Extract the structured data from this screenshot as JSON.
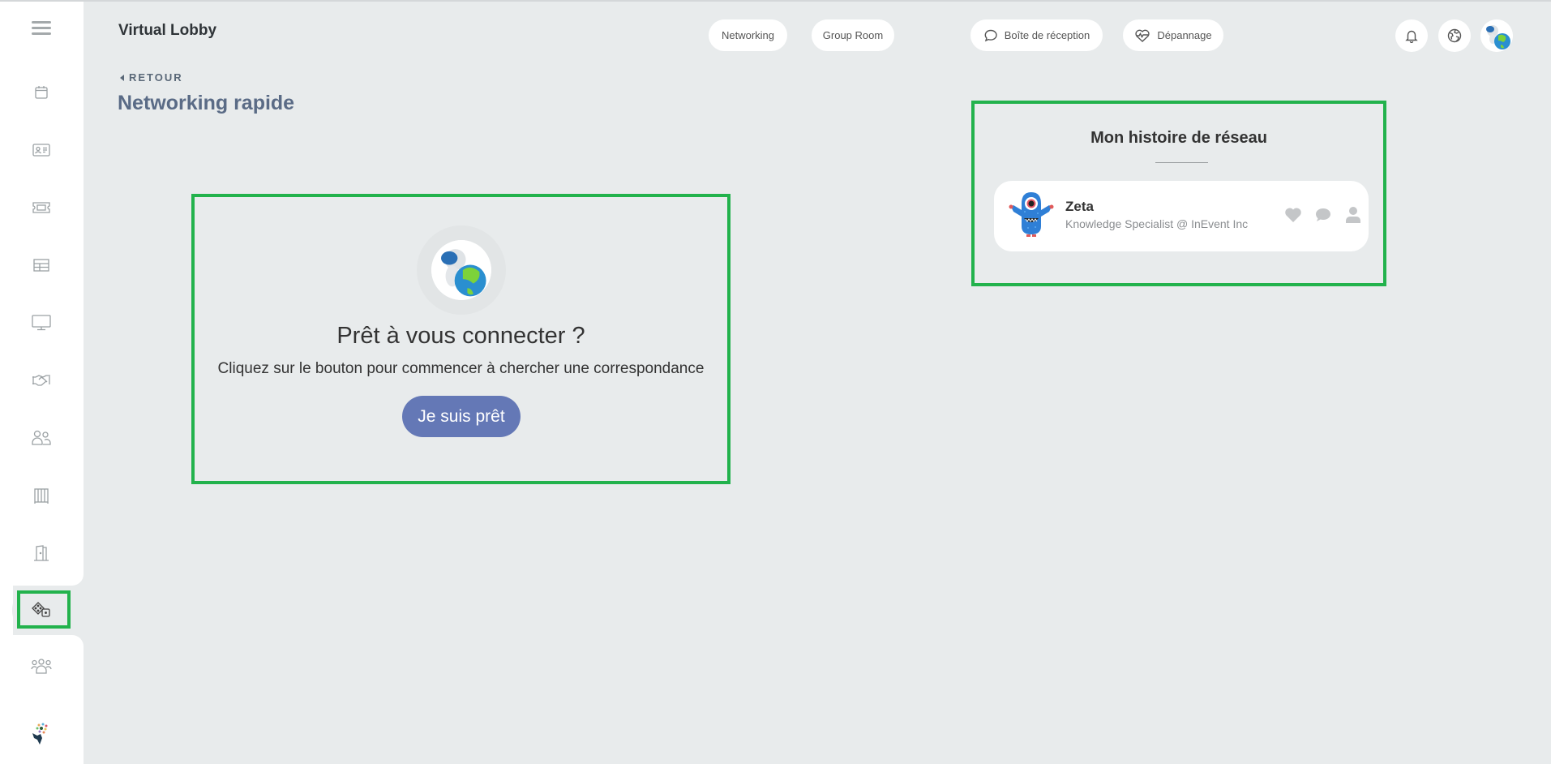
{
  "header": {
    "app_title": "Virtual Lobby",
    "pills": [
      {
        "label": "Networking",
        "icon": ""
      },
      {
        "label": "Group Room",
        "icon": ""
      },
      {
        "label": "Boîte de réception",
        "icon": "chat-bubble-icon"
      },
      {
        "label": "Dépannage",
        "icon": "heartbeat-icon"
      }
    ],
    "right_icons": [
      "bell-icon",
      "globe-icon",
      "user-avatar"
    ]
  },
  "sidebar": {
    "items": [
      {
        "name": "menu",
        "icon": "hamburger-icon"
      },
      {
        "name": "agenda",
        "icon": "calendar-icon"
      },
      {
        "name": "profile",
        "icon": "id-card-icon"
      },
      {
        "name": "tickets",
        "icon": "ticket-icon"
      },
      {
        "name": "schedule",
        "icon": "table-icon"
      },
      {
        "name": "stage",
        "icon": "monitor-icon"
      },
      {
        "name": "sponsors",
        "icon": "handshake-icon"
      },
      {
        "name": "attendees",
        "icon": "users-icon"
      },
      {
        "name": "booths",
        "icon": "radiator-icon"
      },
      {
        "name": "rooms",
        "icon": "door-icon"
      },
      {
        "name": "speed-networking",
        "icon": "dice-icon",
        "active": true
      },
      {
        "name": "groups",
        "icon": "group-icon"
      }
    ]
  },
  "page": {
    "back_label": "RETOUR",
    "title": "Networking rapide"
  },
  "ready": {
    "title": "Prêt à vous connecter ?",
    "subtitle": "Cliquez sur le bouton pour commencer à chercher une correspondance",
    "button_label": "Je suis prêt"
  },
  "history": {
    "title": "Mon histoire de réseau",
    "people": [
      {
        "name": "Zeta",
        "role": "Knowledge Specialist @ InEvent Inc",
        "actions": [
          "heart-icon",
          "chat-icon",
          "profile-icon"
        ]
      }
    ]
  },
  "colors": {
    "accent": "#6478b6",
    "highlight": "#22b24c",
    "background": "#e8ebec",
    "title": "#5a6b86"
  }
}
